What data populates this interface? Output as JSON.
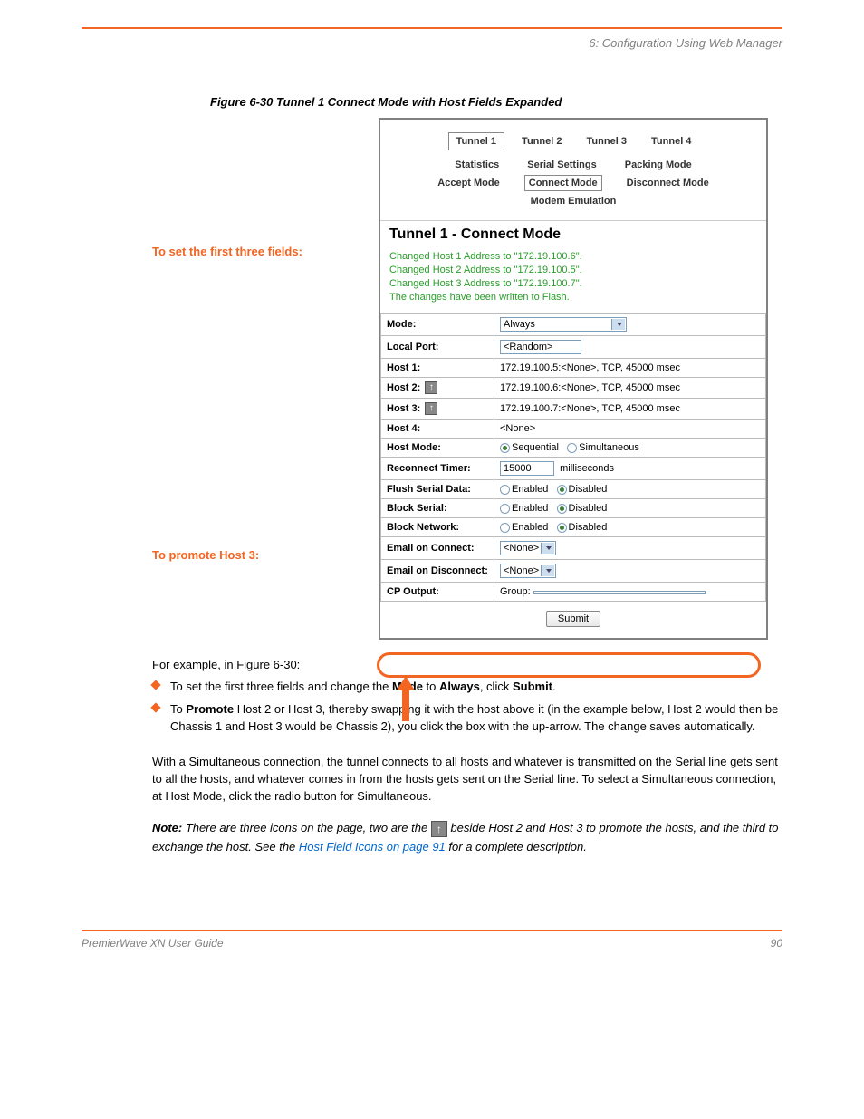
{
  "header": {
    "right": "6: Configuration Using Web Manager"
  },
  "caption": "Figure 6-30  Tunnel 1 Connect Mode with Host Fields Expanded",
  "intro": "For example, in Figure 6-30:",
  "bullets": {
    "a_lead": "To set the first three fields and change the ",
    "a_bold": "Mode",
    "a_mid": " to ",
    "a_bold2": "Always",
    "a_tail": ", click ",
    "a_btn": "Submit",
    "a_end": ".",
    "b_lead": "To ",
    "b_bold": "Promote",
    "b_tail": " Host 2 or Host 3, thereby swapping it with the host above it (in the example below, Host 2 would then be Chassis 1 and Host 3 would be Chassis 2), you click the box with the up-arrow. The change saves automatically."
  },
  "tabs": {
    "t1": "Tunnel 1",
    "t2": "Tunnel 2",
    "t3": "Tunnel 3",
    "t4": "Tunnel 4"
  },
  "sublinks": {
    "stats": "Statistics",
    "serial": "Serial Settings",
    "packing": "Packing Mode",
    "accept": "Accept Mode",
    "connect": "Connect Mode",
    "disconnect": "Disconnect Mode",
    "modem": "Modem Emulation"
  },
  "panel_title": "Tunnel 1 - Connect Mode",
  "status": {
    "l1": "Changed Host 1 Address to \"172.19.100.6\".",
    "l2": "Changed Host 2 Address to \"172.19.100.5\".",
    "l3": "Changed Host 3 Address to \"172.19.100.7\".",
    "l4": "The changes have been written to Flash."
  },
  "rows": {
    "mode_k": "Mode:",
    "mode_v": "Always",
    "localport_k": "Local Port:",
    "localport_v": "<Random>",
    "h1_k": "Host 1:",
    "h1_v": "172.19.100.5:<None>, TCP, 45000 msec",
    "h2_k": "Host 2:",
    "h2_v": "172.19.100.6:<None>, TCP, 45000 msec",
    "h3_k": "Host 3:",
    "h3_v": "172.19.100.7:<None>, TCP, 45000 msec",
    "h4_k": "Host 4:",
    "h4_v": "<None>",
    "hostmode_k": "Host Mode:",
    "hostmode_seq": "Sequential",
    "hostmode_sim": "Simultaneous",
    "reconn_k": "Reconnect Timer:",
    "reconn_v": "15000",
    "reconn_unit": "milliseconds",
    "flush_k": "Flush Serial Data:",
    "en": "Enabled",
    "dis": "Disabled",
    "bserial_k": "Block Serial:",
    "bnet_k": "Block Network:",
    "eoc_k": "Email on Connect:",
    "eoc_v": "<None>",
    "eod_k": "Email on Disconnect:",
    "eod_v": "<None>",
    "cpo_k": "CP Output:",
    "cpo_lbl": "Group:"
  },
  "submit": "Submit",
  "left_labels": {
    "set": "To set the first three fields:",
    "prom": "To promote Host 3:"
  },
  "post": {
    "p1": "With a Simultaneous connection, the tunnel connects to all hosts and whatever is transmitted on the Serial line gets sent to all the hosts, and whatever comes in from the hosts gets sent on the Serial line. To select a Simultaneous connection, at Host Mode, click the radio button for Simultaneous.",
    "note_label": "Note:",
    "note_body_a": " There are three icons on the page, two are the ",
    "note_body_b": " beside Host 2 and Host 3 to promote the hosts, and the third to exchange the host. See the ",
    "note_link": "Host Field Icons on page 91",
    "note_body_c": " for a complete description."
  },
  "footer": {
    "left": "PremierWave XN User Guide",
    "right": "90"
  }
}
